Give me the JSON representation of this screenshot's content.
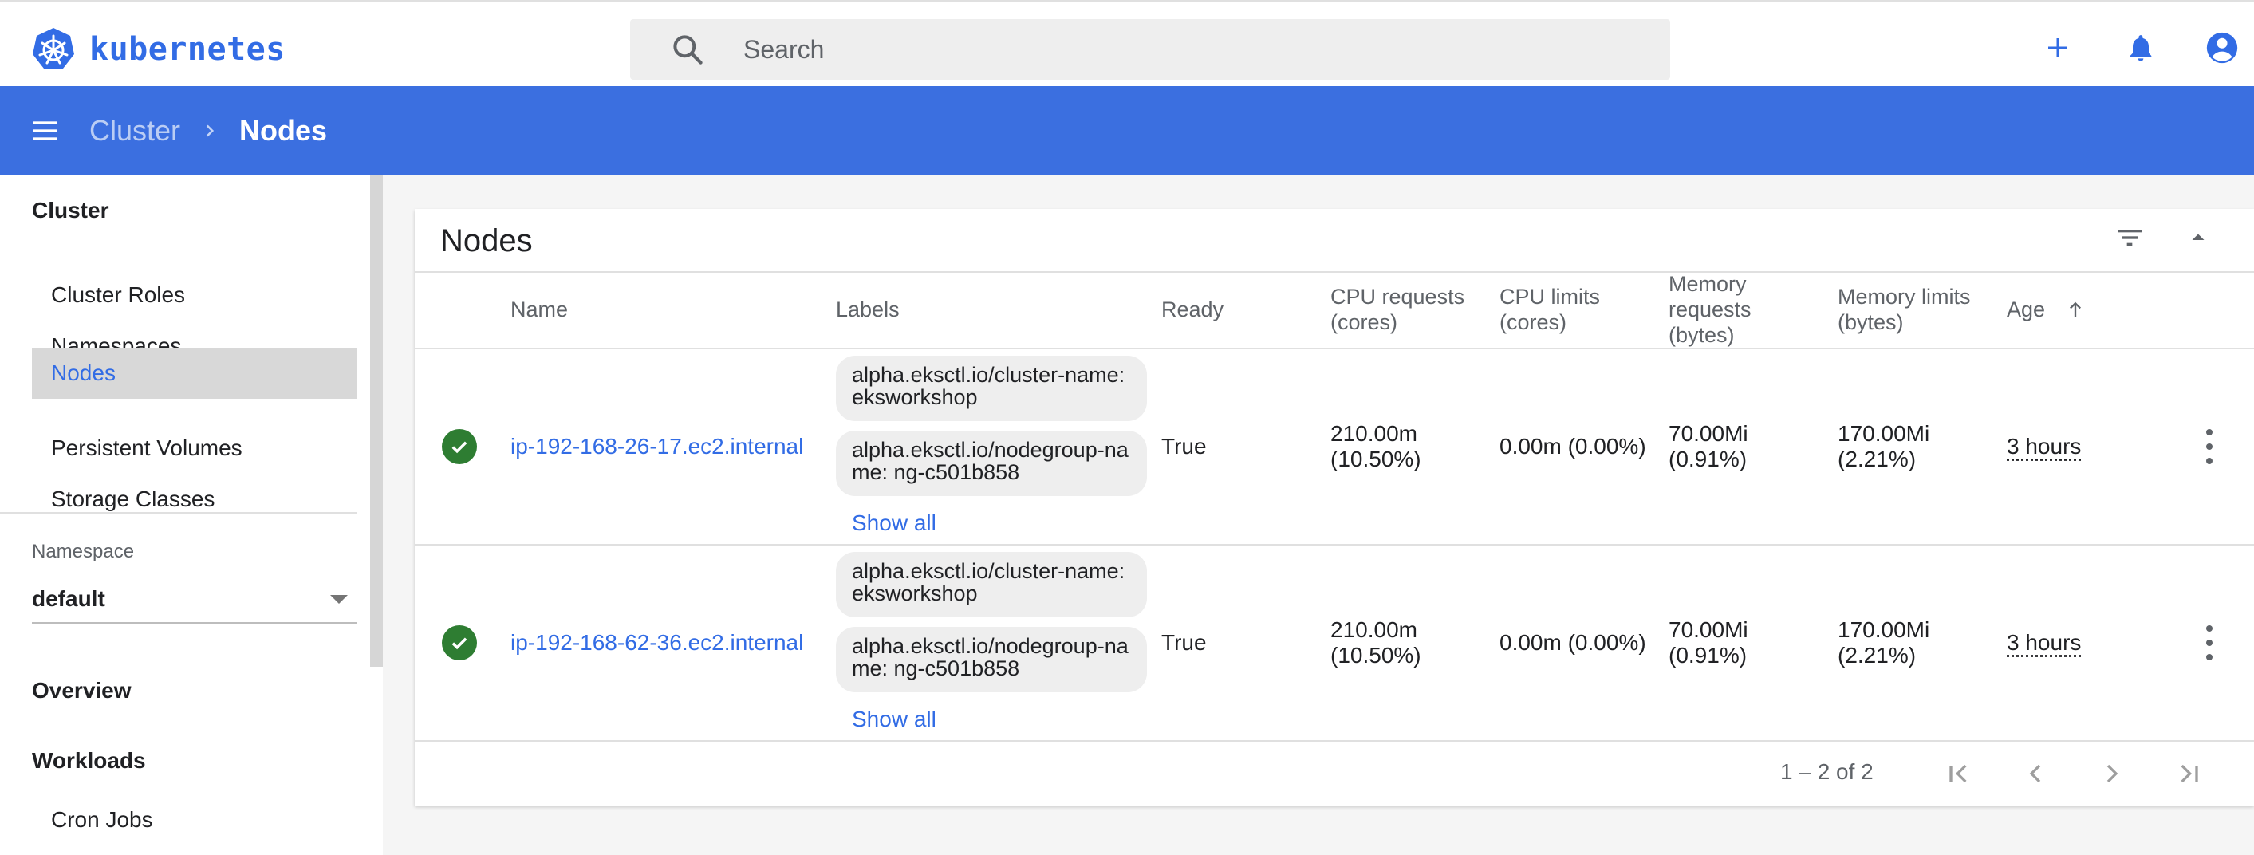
{
  "app": {
    "logo_text": "kubernetes"
  },
  "search": {
    "placeholder": "Search"
  },
  "breadcrumb": {
    "parent": "Cluster",
    "current": "Nodes"
  },
  "sidebar": {
    "cluster_title": "Cluster",
    "cluster_items": [
      "Cluster Roles",
      "Namespaces",
      "Nodes",
      "Persistent Volumes",
      "Storage Classes"
    ],
    "active_item": "Nodes",
    "namespace_label": "Namespace",
    "namespace_value": "default",
    "overview_title": "Overview",
    "workloads_title": "Workloads",
    "workloads_items": [
      "Cron Jobs"
    ]
  },
  "card": {
    "title": "Nodes",
    "columns": {
      "name": "Name",
      "labels": "Labels",
      "ready": "Ready",
      "cpu_requests": [
        "CPU requests",
        "(cores)"
      ],
      "cpu_limits": [
        "CPU limits",
        "(cores)"
      ],
      "memory_requests": [
        "Memory",
        "requests",
        "(bytes)"
      ],
      "memory_limits": [
        "Memory limits",
        "(bytes)"
      ],
      "age": "Age"
    },
    "rows": [
      {
        "name": "ip-192-168-26-17.ec2.internal",
        "labels": [
          "alpha.eksctl.io/cluster-name: eksworkshop",
          "alpha.eksctl.io/nodegroup-name: ng-c501b858"
        ],
        "show_all": "Show all",
        "ready": "True",
        "cpu_requests": [
          "210.00m",
          "(10.50%)"
        ],
        "cpu_limits": "0.00m (0.00%)",
        "memory_requests": [
          "70.00Mi",
          "(0.91%)"
        ],
        "memory_limits": [
          "170.00Mi",
          "(2.21%)"
        ],
        "age": "3 hours"
      },
      {
        "name": "ip-192-168-62-36.ec2.internal",
        "labels": [
          "alpha.eksctl.io/cluster-name: eksworkshop",
          "alpha.eksctl.io/nodegroup-name: ng-c501b858"
        ],
        "show_all": "Show all",
        "ready": "True",
        "cpu_requests": [
          "210.00m",
          "(10.50%)"
        ],
        "cpu_limits": "0.00m (0.00%)",
        "memory_requests": [
          "70.00Mi",
          "(0.91%)"
        ],
        "memory_limits": [
          "170.00Mi",
          "(2.21%)"
        ],
        "age": "3 hours"
      }
    ],
    "pagination": "1 – 2 of 2"
  },
  "colors": {
    "brand": "#326ce5",
    "header": "#3b6fe0",
    "status_ok": "#2e7d32"
  },
  "icons": [
    "kubernetes-logo-icon",
    "search-icon",
    "plus-icon",
    "bell-icon",
    "account-icon",
    "menu-icon",
    "chevron-right-icon",
    "filter-icon",
    "caret-up-icon",
    "arrow-up-icon",
    "check-circle-icon",
    "more-vert-icon",
    "first-page-icon",
    "prev-page-icon",
    "next-page-icon",
    "last-page-icon"
  ]
}
